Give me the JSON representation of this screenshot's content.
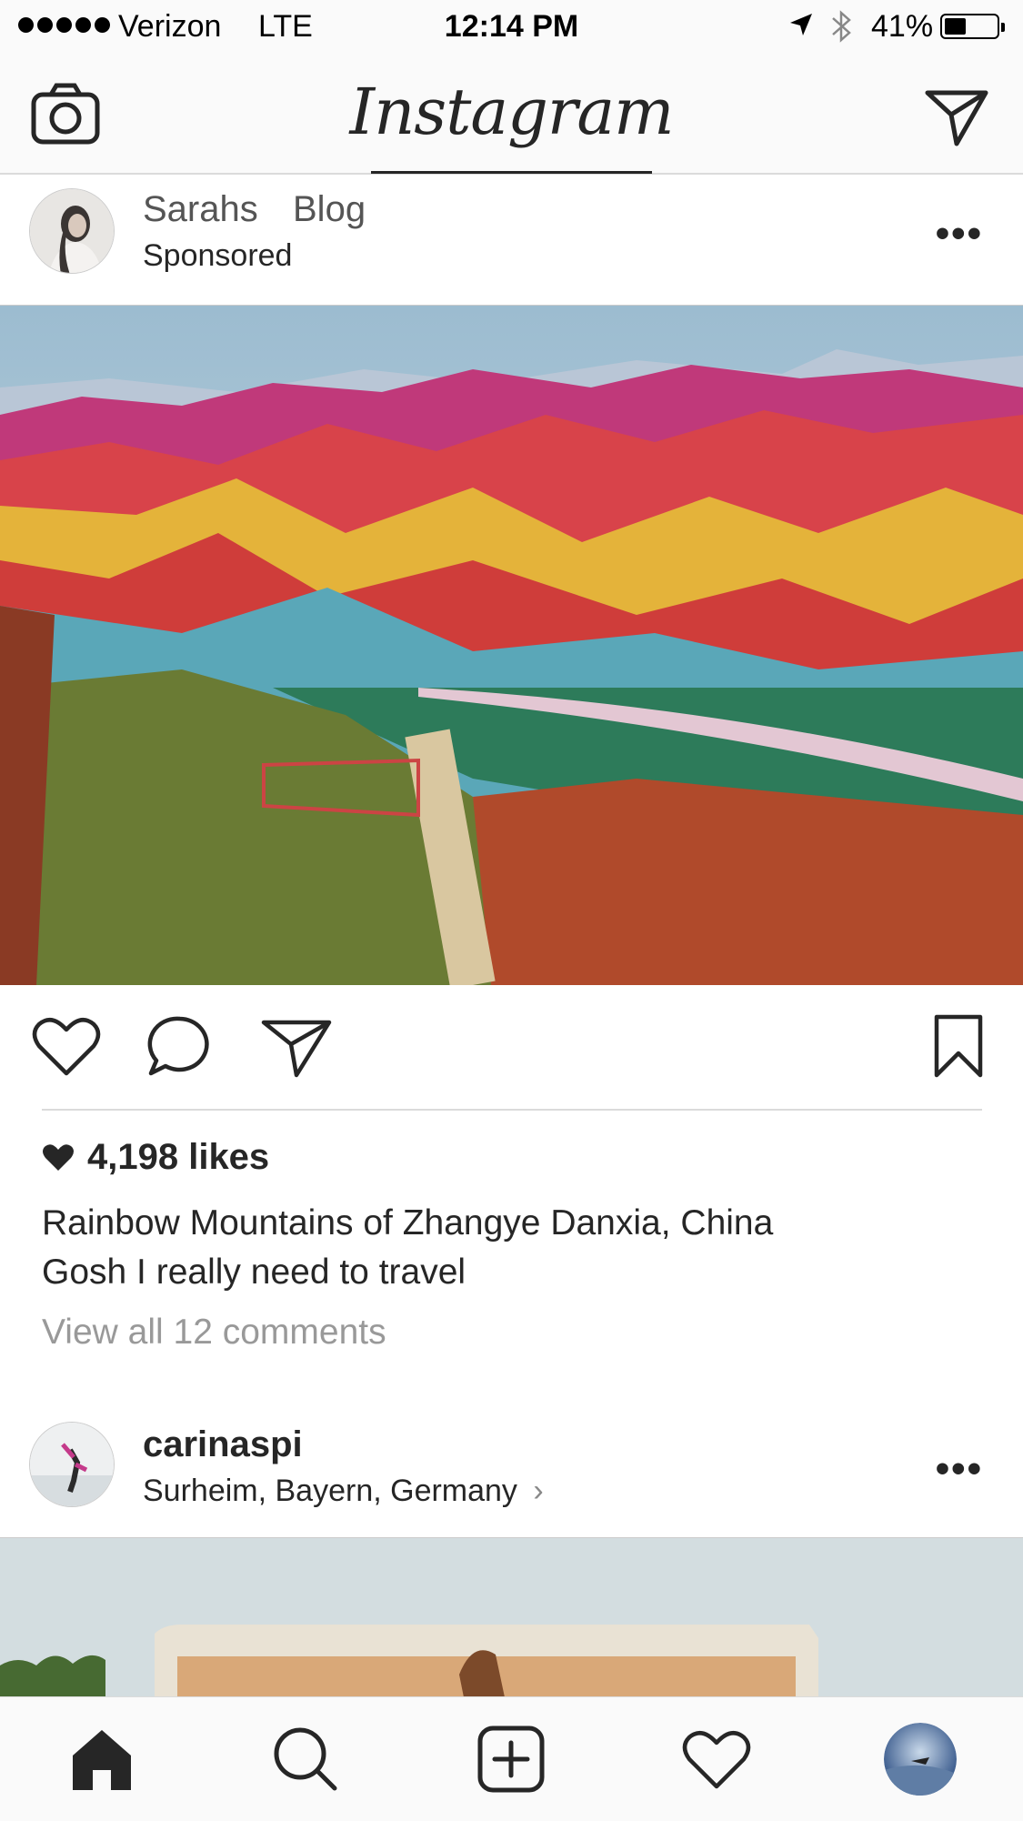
{
  "status_bar": {
    "carrier": "Verizon",
    "network": "LTE",
    "time": "12:14 PM",
    "battery_percent": "41%",
    "battery_level": 0.41
  },
  "nav": {
    "title": "Instagram",
    "left_icon": "camera-icon",
    "right_icon": "direct-message-icon"
  },
  "post1": {
    "username_first": "Sarahs",
    "username_second": "Blog",
    "subtitle": "Sponsored",
    "more_label": "•••",
    "image_description": "rainbow-mountains-photo",
    "likes": "4,198 likes",
    "caption_line1": "Rainbow Mountains of Zhangye Danxia, China",
    "caption_line2": "Gosh I really need to travel",
    "view_comments": "View all 12 comments"
  },
  "post2": {
    "username": "carinaspi",
    "location": "Surheim, Bayern, Germany",
    "location_chevron": "›",
    "more_label": "•••"
  },
  "tabbar": {
    "items": [
      "home-icon",
      "search-icon",
      "add-post-icon",
      "activity-heart-icon",
      "profile-avatar"
    ]
  }
}
